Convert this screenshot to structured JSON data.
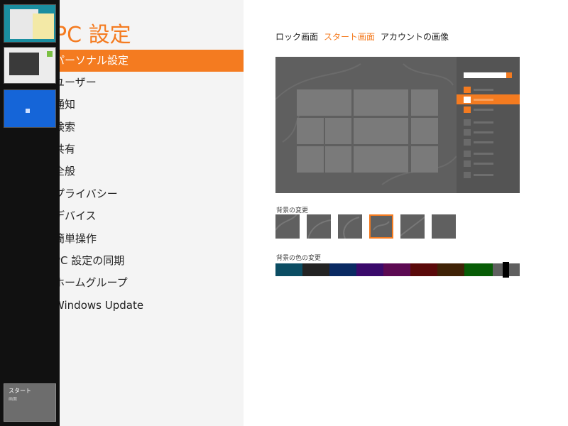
{
  "switcher": {
    "thumbs": [
      {
        "name": "desktop"
      },
      {
        "name": "media"
      },
      {
        "name": "blue-app"
      }
    ],
    "start_tile": {
      "label": "スタート",
      "sub": "画面"
    }
  },
  "left": {
    "title": "PC 設定",
    "categories": [
      {
        "label": "パーソナル設定",
        "selected": true
      },
      {
        "label": "ユーザー"
      },
      {
        "label": "通知"
      },
      {
        "label": "検索"
      },
      {
        "label": "共有"
      },
      {
        "label": "全般"
      },
      {
        "label": "プライバシー"
      },
      {
        "label": "デバイス"
      },
      {
        "label": "簡単操作"
      },
      {
        "label": "PC 設定の同期"
      },
      {
        "label": "ホームグループ"
      },
      {
        "label": "Windows Update"
      }
    ]
  },
  "tabs": [
    {
      "label": "ロック画面"
    },
    {
      "label": "スタート画面",
      "active": true
    },
    {
      "label": "アカウントの画像"
    }
  ],
  "background": {
    "label": "背景の変更",
    "selected_index": 3,
    "count": 6
  },
  "background_color": {
    "label": "背景の色の変更",
    "colors": [
      "#0b4d63",
      "#232323",
      "#0a2a62",
      "#3a0a6b",
      "#5c0a52",
      "#5a0a0a",
      "#3f2206",
      "#075c06",
      "#5f5f5f"
    ],
    "selected_color": "#5f5f5f"
  },
  "colors": {
    "accent": "#f47b20",
    "preview_bg": "#5f5f5f"
  }
}
